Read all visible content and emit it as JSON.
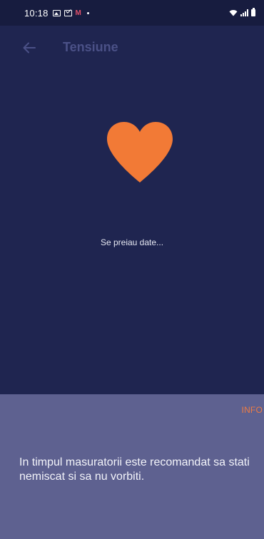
{
  "status_bar": {
    "time": "10:18",
    "notification_app": "M",
    "icons": [
      "gallery-icon",
      "mail-icon",
      "app-notification-icon",
      "more-dot-icon",
      "wifi-icon",
      "signal-icon",
      "battery-icon"
    ]
  },
  "app_bar": {
    "title": "Tensiune",
    "back_icon": "arrow-left-icon"
  },
  "measurement": {
    "heart_icon": "heart-icon",
    "heart_color": "#f27a36",
    "status_text": "Se preiau date..."
  },
  "info_panel": {
    "info_label": "INFO",
    "message": "In timpul masuratorii este recomandat sa stati nemiscat si sa nu vorbiti.",
    "accent_color": "#ee7c44"
  },
  "colors": {
    "background": "#1f2550",
    "panel": "#5e6190",
    "status_bar": "#171c3f"
  }
}
